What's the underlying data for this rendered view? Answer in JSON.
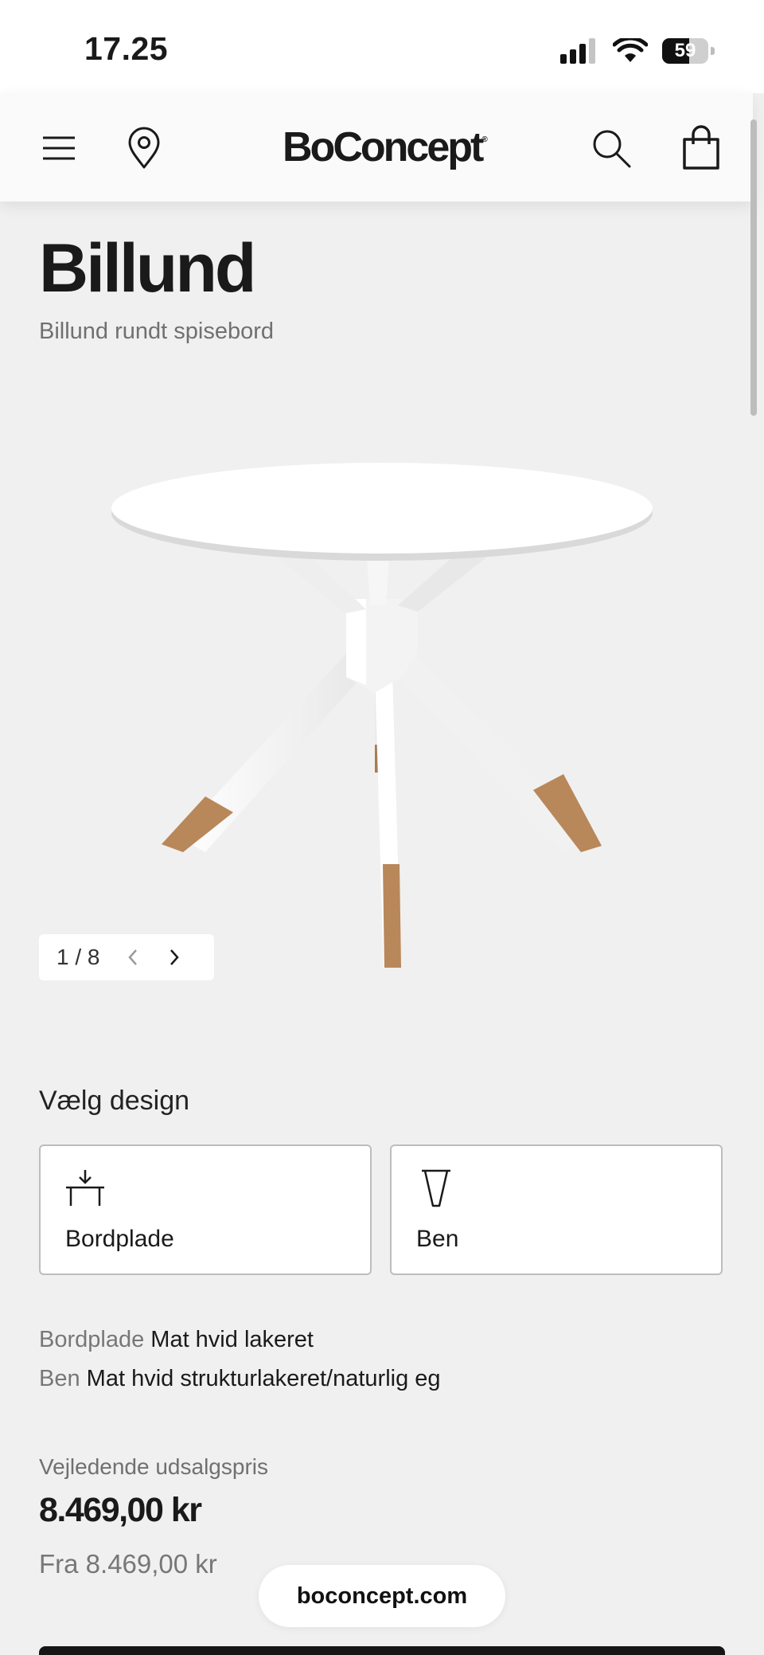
{
  "status_bar": {
    "time": "17.25",
    "battery_level": "59"
  },
  "header": {
    "logo": "BoConcept",
    "logo_mark": "®"
  },
  "product": {
    "name": "Billund",
    "subtitle": "Billund rundt spisebord"
  },
  "gallery": {
    "counter": "1 / 8"
  },
  "design": {
    "title": "Vælg design",
    "options": [
      {
        "label": "Bordplade",
        "icon": "tabletop-icon"
      },
      {
        "label": "Ben",
        "icon": "leg-icon"
      }
    ]
  },
  "specs": [
    {
      "key": "Bordplade",
      "value": "Mat hvid lakeret"
    },
    {
      "key": "Ben",
      "value": "Mat hvid strukturlakeret/naturlig eg"
    }
  ],
  "pricing": {
    "label": "Vejledende udsalgspris",
    "price": "8.469,00 kr",
    "from": "Fra 8.469,00 kr"
  },
  "browser": {
    "url": "boconcept.com"
  },
  "colors": {
    "background": "#f0f0f0",
    "text": "#1a1a1a",
    "muted": "#707070",
    "wood": "#b8875a"
  }
}
